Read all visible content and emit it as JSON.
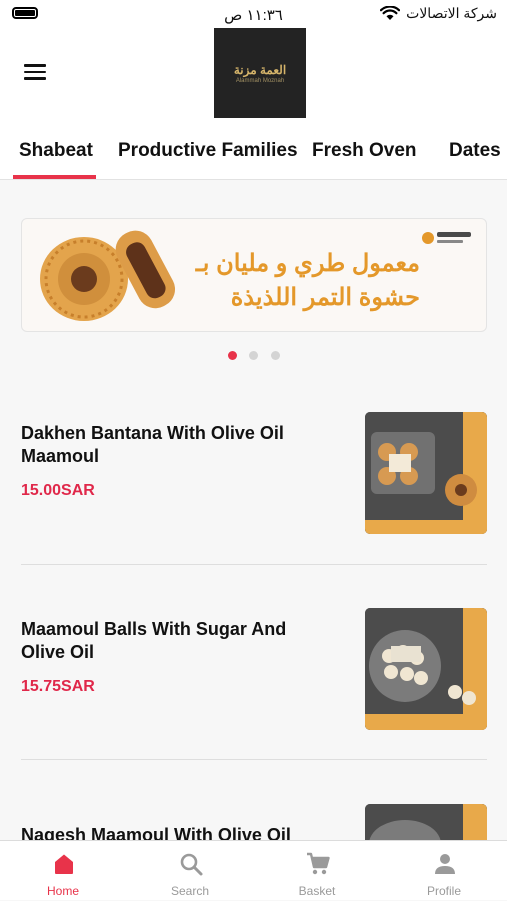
{
  "status_bar": {
    "time": "١١:٣٦ ص",
    "carrier": "شركة الاتصالات",
    "wifi_icon": "wifi-icon",
    "battery_icon": "battery-icon"
  },
  "header": {
    "logo_ar": "العمة مزنة",
    "logo_en": "Alammah Moznah",
    "menu_icon": "hamburger-menu-icon"
  },
  "tabs": [
    {
      "label": "Shabeat"
    },
    {
      "label": "Productive Families"
    },
    {
      "label": "Fresh Oven"
    },
    {
      "label": "Dates"
    }
  ],
  "active_tab": "Shabeat",
  "banner": {
    "line1": "معمول طري و مليان بـ",
    "line2": "حشوة التمر اللذيذة",
    "dots_count": 3,
    "active_dot": 1
  },
  "products": [
    {
      "name": "Dakhen Bantana With Olive Oil Maamoul",
      "price": "15.00SAR"
    },
    {
      "name": "Maamoul Balls With Sugar And Olive Oil",
      "price": "15.75SAR"
    },
    {
      "name": "Nagesh Maamoul With Olive Oil",
      "price": ""
    }
  ],
  "bottom_nav": [
    {
      "label": "Home",
      "icon": "home-icon",
      "active": true
    },
    {
      "label": "Search",
      "icon": "search-icon",
      "active": false
    },
    {
      "label": "Basket",
      "icon": "cart-icon",
      "active": false
    },
    {
      "label": "Profile",
      "icon": "person-icon",
      "active": false
    }
  ],
  "colors": {
    "accent": "#e8334a",
    "price": "#e0284a",
    "banner_text": "#e4982a",
    "inactive_nav": "#9a9a9a"
  }
}
